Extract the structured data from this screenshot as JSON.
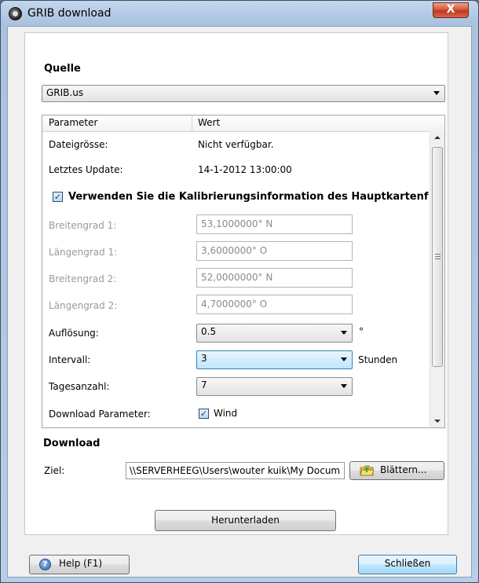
{
  "window": {
    "title": "GRIB download",
    "close_glyph": "X"
  },
  "source": {
    "section_label": "Quelle",
    "selected": "GRIB.us"
  },
  "table": {
    "headers": {
      "parameter": "Parameter",
      "value": "Wert"
    },
    "file_size": {
      "label": "Dateigrösse:",
      "value": "Nicht verfügbar."
    },
    "last_update": {
      "label": "Letztes Update:",
      "value": "14-1-2012 13:00:00"
    },
    "calibration": {
      "checked": true,
      "label": "Verwenden Sie die Kalibrierungsinformation des Hauptkartenf"
    },
    "lat1": {
      "label": "Breitengrad 1:",
      "value": "53,1000000° N"
    },
    "lon1": {
      "label": "Längengrad 1:",
      "value": "3,6000000° O"
    },
    "lat2": {
      "label": "Breitengrad 2:",
      "value": "52,0000000° N"
    },
    "lon2": {
      "label": "Längengrad 2:",
      "value": "4,7000000° O"
    },
    "resolution": {
      "label": "Auflösung:",
      "value": "0.5",
      "unit": "°"
    },
    "interval": {
      "label": "Intervall:",
      "value": "3",
      "unit": "Stunden"
    },
    "days": {
      "label": "Tagesanzahl:",
      "value": "7"
    },
    "download_params": {
      "label": "Download Parameter:",
      "wind_checked": true,
      "wind_label": "Wind"
    }
  },
  "download": {
    "section_label": "Download",
    "target_label": "Ziel:",
    "target_value": "\\\\SERVERHEEG\\Users\\wouter kuik\\My Docum",
    "browse_label": "Blättern...",
    "download_button": "Herunterladen"
  },
  "footer": {
    "help_label": "Help (F1)",
    "close_label": "Schließen"
  },
  "icons": {
    "app": "app-icon",
    "help": "help-icon",
    "folder": "folder-icon"
  },
  "colors": {
    "accent": "#3c7fb1",
    "close_button": "#c1361c",
    "disabled_text": "#9a9a9a"
  }
}
